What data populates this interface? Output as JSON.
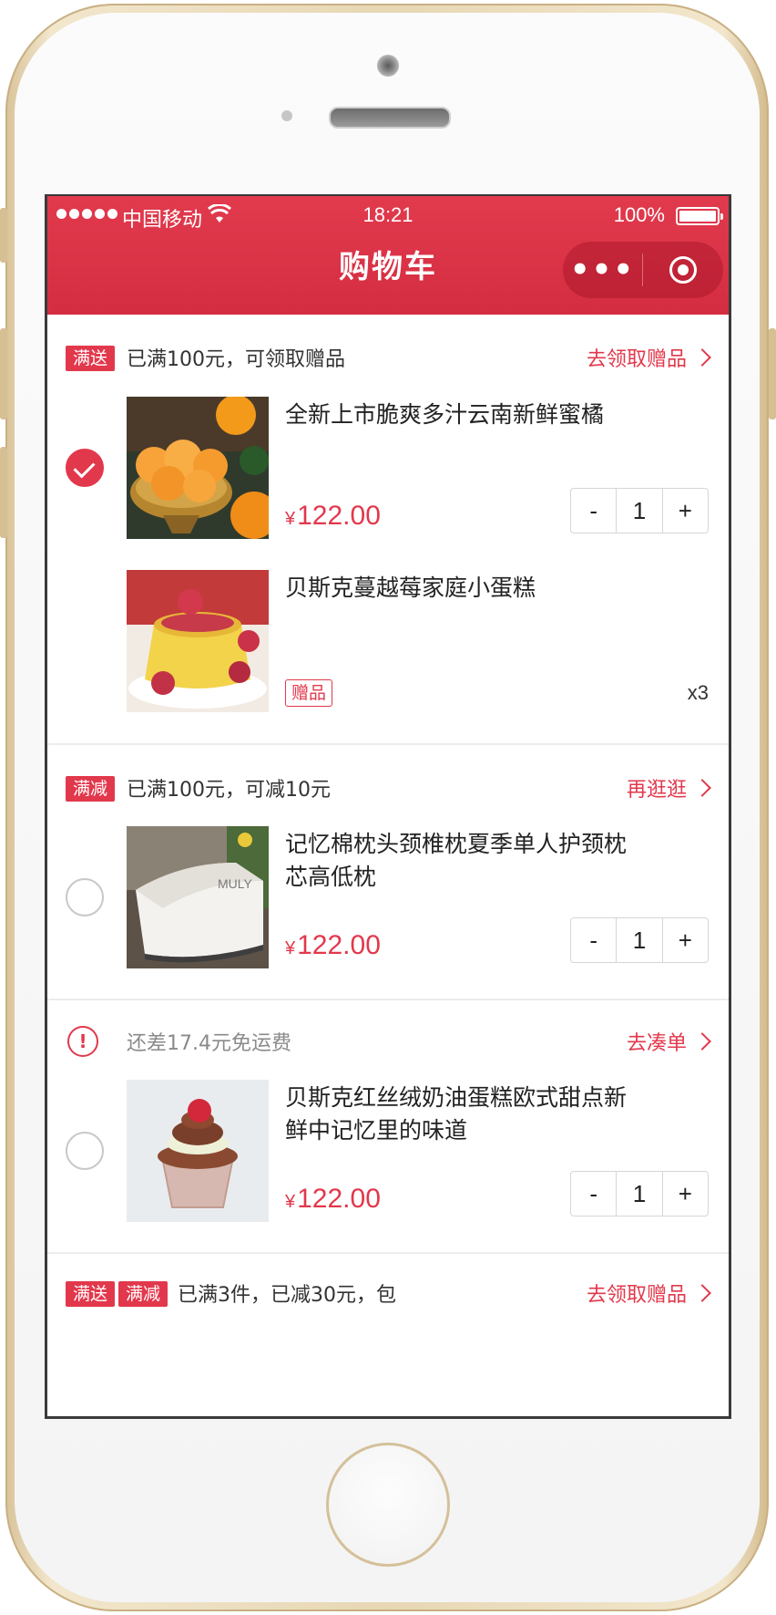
{
  "status_bar": {
    "carrier": "中国移动",
    "time": "18:21",
    "battery": "100%"
  },
  "nav": {
    "title": "购物车",
    "more_label": "•••"
  },
  "groups": [
    {
      "tags": [
        "满送"
      ],
      "description": "已满100元，可领取赠品",
      "action": "去领取赠品",
      "items": [
        {
          "title": "全新上市脆爽多汁云南新鲜蜜橘",
          "price_symbol": "¥",
          "price": "122.00",
          "quantity": "1",
          "checked": true,
          "image": "mandarin-oranges"
        },
        {
          "title": "贝斯克蔓越莓家庭小蛋糕",
          "gift_tag": "赠品",
          "gift_quantity": "x3",
          "image": "pudding-cake"
        }
      ]
    },
    {
      "tags": [
        "满减"
      ],
      "description": "已满100元，可减10元",
      "action": "再逛逛",
      "items": [
        {
          "title": "记忆棉枕头颈椎枕夏季单人护颈枕芯高低枕",
          "price_symbol": "¥",
          "price": "122.00",
          "quantity": "1",
          "checked": false,
          "image": "memory-foam-pillow"
        }
      ]
    },
    {
      "warning_icon": "exclamation-circle-icon",
      "description": "还差17.4元免运费",
      "action": "去凑单",
      "items": [
        {
          "title": "贝斯克红丝绒奶油蛋糕欧式甜点新鲜中记忆里的味道",
          "price_symbol": "¥",
          "price": "122.00",
          "quantity": "1",
          "checked": false,
          "image": "red-velvet-cupcake"
        }
      ]
    },
    {
      "tags": [
        "满送",
        "满减"
      ],
      "description": "已满3件，已减30元，包",
      "action": "去领取赠品"
    }
  ],
  "stepper": {
    "minus": "-",
    "plus": "+"
  },
  "colors": {
    "accent": "#e2384c",
    "nav_bar": "#d42d41",
    "frame_gold": "#e7d7b4"
  }
}
